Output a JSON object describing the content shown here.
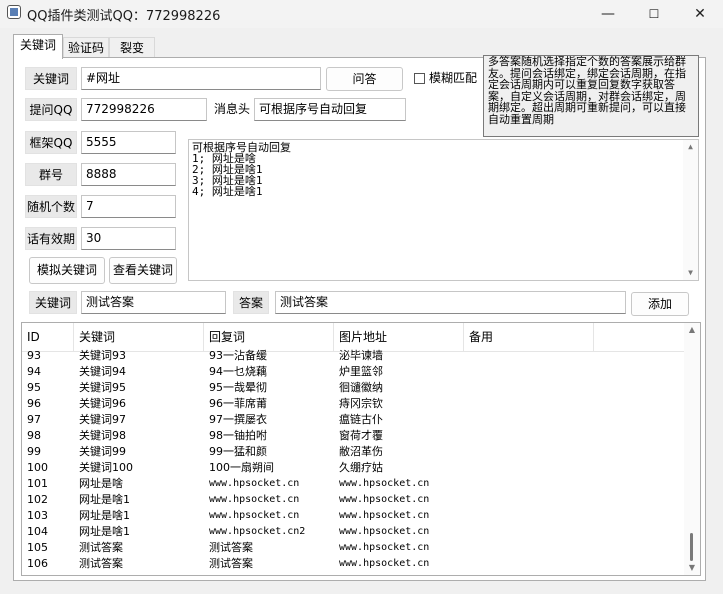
{
  "window": {
    "title": "QQ插件类测试QQ：772998226",
    "minimize": "—",
    "maximize": "☐",
    "close": "✕"
  },
  "tabs": [
    {
      "label": "关键词",
      "active": true
    },
    {
      "label": "验证码",
      "active": false
    },
    {
      "label": "裂变",
      "active": false
    }
  ],
  "form": {
    "keyword_label": "关键词",
    "keyword_value": "#网址",
    "ask_button": "问答",
    "fuzzy_label": "模糊匹配",
    "fuzzy_checked": false,
    "prompt_qq_label": "提问QQ",
    "prompt_qq_value": "772998226",
    "msg_head_label": "消息头",
    "msg_head_value": "可根据序号自动回复",
    "frame_qq_label": "框架QQ",
    "frame_qq_value": "5555",
    "group_label": "群号",
    "group_value": "8888",
    "random_label": "随机个数",
    "random_value": "7",
    "session_label": "话有效期",
    "session_value": "30",
    "simulate_button": "模拟关键词",
    "view_button": "查看关键词"
  },
  "info_text": "多答案随机选择指定个数的答案展示给群友。提问会话绑定，绑定会话周期，在指定会话周期内可以重复回复数字获取答案，自定义会话周期，对群会话绑定，周期绑定。超出周期可重新提问，可以直接自动重置周期",
  "reply_memo": [
    "可根据序号自动回复",
    "1; 网址是啥",
    "2; 网址是啥1",
    "3; 网址是啥1",
    "4; 网址是啥1"
  ],
  "add_row": {
    "keyword_label": "关键词",
    "keyword_value": "测试答案",
    "answer_label": "答案",
    "answer_value": "测试答案",
    "add_button": "添加"
  },
  "table": {
    "columns": [
      "ID",
      "关键词",
      "回复词",
      "图片地址",
      "备用"
    ],
    "rows": [
      [
        "93",
        "关键词93",
        "93一沾备缓",
        "泌毕谏墙",
        ""
      ],
      [
        "94",
        "关键词94",
        "94一乜烧藕",
        "炉里篮邻",
        ""
      ],
      [
        "95",
        "关键词95",
        "95一哉晕彻",
        "徊谴徽纳",
        ""
      ],
      [
        "96",
        "关键词96",
        "96一菲席莆",
        "痔冈宗钦",
        ""
      ],
      [
        "97",
        "关键词97",
        "97一撰屡衣",
        "瘟链古仆",
        ""
      ],
      [
        "98",
        "关键词98",
        "98一铀拍咐",
        "窗荷才覆",
        ""
      ],
      [
        "99",
        "关键词99",
        "99一猛和颜",
        "敝沼革伤",
        ""
      ],
      [
        "100",
        "关键词100",
        "100一扇朔间",
        "久绷疗姑",
        ""
      ],
      [
        "101",
        "网址是啥",
        "www.hpsocket.cn",
        "www.hpsocket.cn",
        ""
      ],
      [
        "102",
        "网址是啥1",
        "www.hpsocket.cn",
        "www.hpsocket.cn",
        ""
      ],
      [
        "103",
        "网址是啥1",
        "www.hpsocket.cn",
        "www.hpsocket.cn",
        ""
      ],
      [
        "104",
        "网址是啥1",
        "www.hpsocket.cn2",
        "www.hpsocket.cn",
        ""
      ],
      [
        "105",
        "测试答案",
        "测试答案",
        "www.hpsocket.cn",
        ""
      ],
      [
        "106",
        "测试答案",
        "测试答案",
        "www.hpsocket.cn",
        ""
      ]
    ]
  }
}
